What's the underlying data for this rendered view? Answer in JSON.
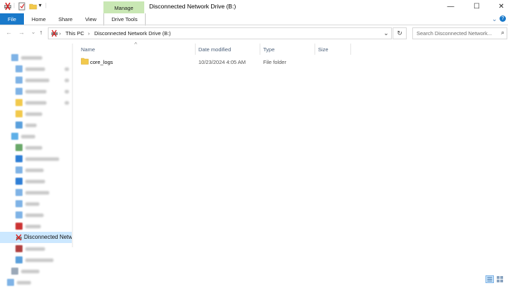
{
  "window": {
    "title": "Disconnected Network Drive (B:)",
    "controls": {
      "minimize": "—",
      "maximize": "☐",
      "close": "✕"
    },
    "qa_separator": "|",
    "qa_dropdown": "▾"
  },
  "ribbon": {
    "contextual_group": "Manage",
    "tabs": [
      "File",
      "Home",
      "Share",
      "View",
      "Drive Tools"
    ],
    "help_icon": "?",
    "expand_icon": "⌄"
  },
  "nav": {
    "back": "←",
    "forward": "→",
    "recent": "⌄",
    "up": "↑",
    "breadcrumb": [
      "This PC",
      "Disconnected Network Drive (B:)"
    ],
    "breadcrumb_sep": "›",
    "address_dropdown": "⌄",
    "refresh": "↻",
    "search_placeholder": "Search Disconnected Network...",
    "search_icon": "⌕"
  },
  "sidebar": {
    "selected_label": "Disconnected Netw",
    "icon_colors": [
      "#7fb3e6",
      "#7fb3e6",
      "#7fb3e6",
      "#7fb3e6",
      "#f2c94c",
      "#f2c94c",
      "#5aa0dc",
      "#5fb0e8",
      "#6aa86a",
      "#2f7fd6",
      "#7fb3e6",
      "#2f7fd6",
      "#7fb3e6",
      "#7fb3e6",
      "#7fb3e6",
      "#cc3333",
      "#9aa8b8",
      "#b04040",
      "#5aa0dc",
      "#9aa8b8"
    ]
  },
  "columns": {
    "name": "Name",
    "date": "Date modified",
    "type": "Type",
    "size": "Size",
    "sort_arrow": "^"
  },
  "files": [
    {
      "name": "core_logs",
      "date": "10/23/2024 4:05 AM",
      "type": "File folder",
      "size": ""
    }
  ],
  "colors": {
    "accent": "#1979ca",
    "contextual": "#c9e7b4",
    "selected": "#cce8ff",
    "folder": "#f2c94c"
  }
}
